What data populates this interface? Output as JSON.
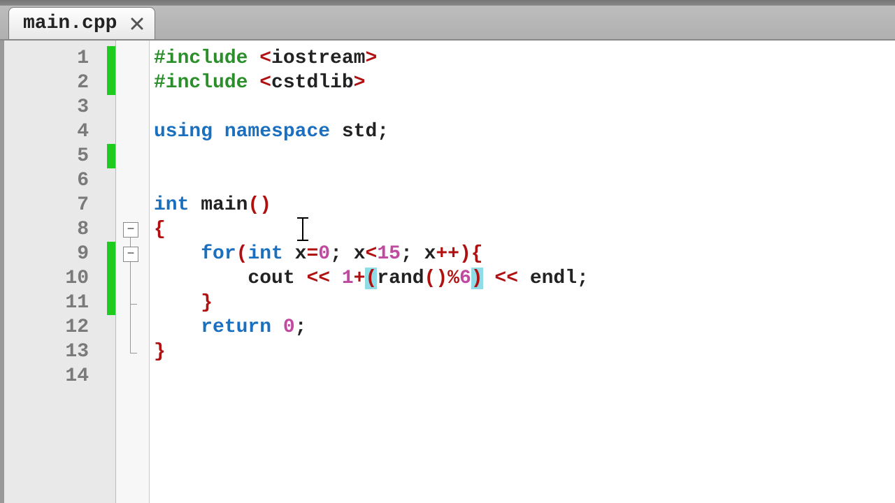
{
  "tab": {
    "filename": "main.cpp"
  },
  "lines": {
    "nums": [
      "1",
      "2",
      "3",
      "4",
      "5",
      "6",
      "7",
      "8",
      "9",
      "10",
      "11",
      "12",
      "13",
      "14"
    ]
  },
  "code": {
    "l1": {
      "pp": "#include ",
      "angle1": "<",
      "hdr": "iostream",
      "angle2": ">"
    },
    "l2": {
      "pp": "#include ",
      "angle1": "<",
      "hdr": "cstdlib",
      "angle2": ">"
    },
    "l4": {
      "kw1": "using ",
      "kw2": "namespace ",
      "id": "std",
      "semi": ";"
    },
    "l7": {
      "kw": "int ",
      "fn": "main",
      "lp": "(",
      "rp": ")"
    },
    "l8": {
      "brace": "{"
    },
    "l9": {
      "indent": "    ",
      "kw1": "for",
      "lp": "(",
      "kw2": "int ",
      "var": "x",
      "eq": "=",
      "n0": "0",
      "semi1": "; ",
      "var2": "x",
      "lt": "<",
      "n15": "15",
      "semi2": "; ",
      "var3": "x",
      "pp": "++",
      "rp": ")",
      "brace": "{"
    },
    "l10": {
      "indent": "        ",
      "cout": "cout ",
      "lsh": "<< ",
      "n1": "1",
      "plus": "+",
      "lp": "(",
      "rand": "rand",
      "lp2": "(",
      "rp2": ")",
      "mod": "%",
      "n6": "6",
      "rp": ")",
      " sp": " ",
      "lsh2": "<< ",
      "endl": "endl",
      "semi": ";"
    },
    "l11": {
      "indent": "    ",
      "brace": "}"
    },
    "l12": {
      "indent": "    ",
      "kw": "return ",
      "n0": "0",
      "semi": ";"
    },
    "l13": {
      "brace": "}"
    }
  },
  "fold": {
    "minus": "−"
  }
}
